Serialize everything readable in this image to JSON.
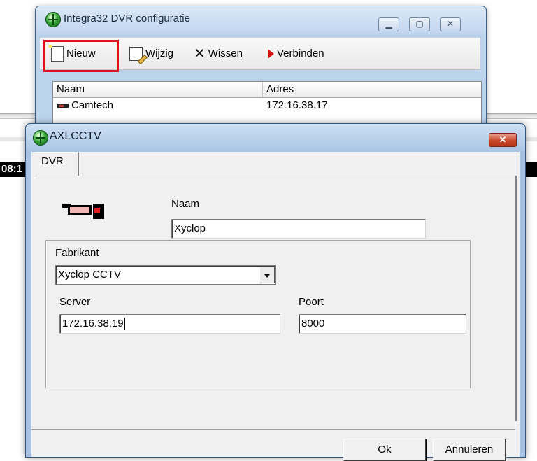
{
  "background": {
    "time_fragment": "08:1"
  },
  "main_window": {
    "title": "Integra32 DVR configuratie",
    "toolbar": {
      "new_label": "Nieuw",
      "edit_label": "Wijzig",
      "delete_label": "Wissen",
      "connect_label": "Verbinden"
    },
    "list": {
      "columns": [
        "Naam",
        "Adres"
      ],
      "rows": [
        {
          "name": "Camtech",
          "address": "172.16.38.17"
        }
      ]
    }
  },
  "dialog": {
    "title": "AXLCCTV",
    "close_glyph": "✕",
    "tab_label": "DVR",
    "name_label": "Naam",
    "name_value": "Xyclop",
    "manufacturer_label": "Fabrikant",
    "manufacturer_value": "Xyclop CCTV",
    "server_label": "Server",
    "server_value": "172.16.38.19",
    "port_label": "Poort",
    "port_value": "8000",
    "ok_label": "Ok",
    "cancel_label": "Annuleren"
  },
  "colors": {
    "highlight": "#e3111c",
    "close_button": "#c7452c"
  }
}
